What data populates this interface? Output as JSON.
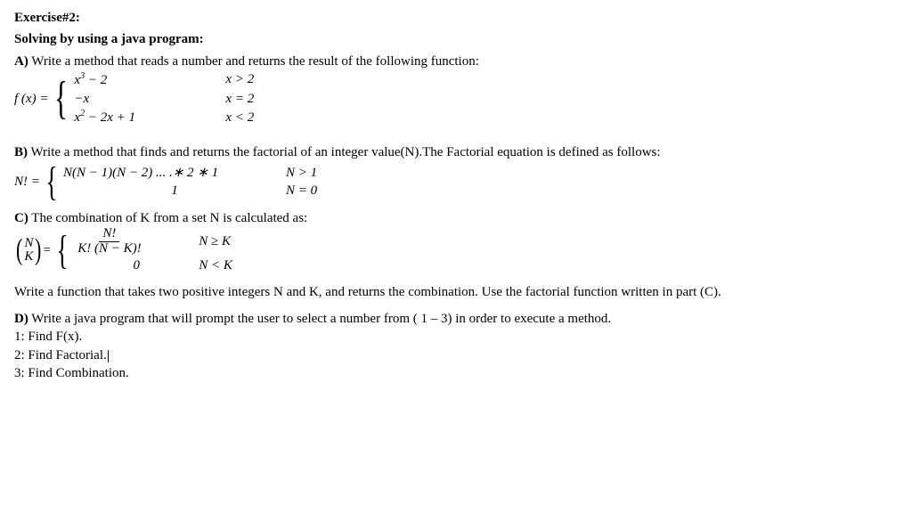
{
  "ex_title": "Exercise#2:",
  "subtitle": "Solving by using a java program:",
  "partA": {
    "label": "A)",
    "text": " Write a method that reads a number and returns the result of the following function:",
    "lhs": "f (x) = ",
    "cases": [
      {
        "expr_a": "x",
        "expr_b": " − 2",
        "sup": "3",
        "cond_lhs": "x",
        "cond_op": " > ",
        "cond_rhs": "2"
      },
      {
        "expr_a": "−x",
        "expr_b": "",
        "sup": "",
        "cond_lhs": "x",
        "cond_op": " = ",
        "cond_rhs": "2"
      },
      {
        "expr_a": "x",
        "expr_b": " − 2x + 1",
        "sup": "2",
        "cond_lhs": "x",
        "cond_op": " < ",
        "cond_rhs": "2"
      }
    ]
  },
  "partB": {
    "label": "B)",
    "text": " Write a method that finds and returns the factorial of an integer value(N).The Factorial equation is defined as follows:",
    "lhs": "N! = ",
    "cases": [
      {
        "expr": "N(N − 1)(N − 2) ... .∗ 2 ∗ 1",
        "cond": "N > 1"
      },
      {
        "expr": "1",
        "cond": "N = 0"
      }
    ]
  },
  "partC": {
    "label": "C)",
    "text": " The combination of K from a set N is calculated as:",
    "binom_top": "N",
    "binom_bot": "K",
    "eq": " = ",
    "cases": [
      {
        "num": "N!",
        "den": "K! (N − K)!",
        "cond": "N ≥ K"
      },
      {
        "expr": "0",
        "cond": "N < K"
      }
    ],
    "tail1": "Write a function that takes two positive integers N and K, and returns the combination. Use the factorial function written in part (C)."
  },
  "partD": {
    "label": "D)",
    "text": " Write a java program that will prompt the user to select a number from ( 1 – 3) in order to execute a method.",
    "opt1": "1: Find F(x).",
    "opt2": "2: Find Factorial.",
    "opt3": "3: Find Combination."
  }
}
